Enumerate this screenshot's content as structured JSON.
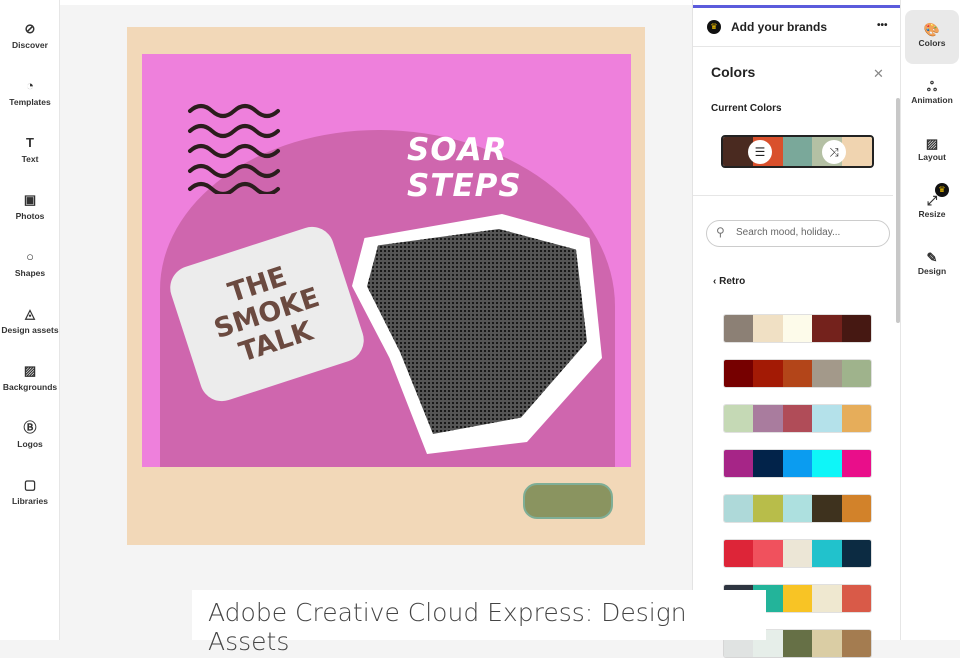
{
  "left_nav": [
    {
      "label": "Discover",
      "icon": "compass-icon",
      "glyph": "⊘"
    },
    {
      "label": "Templates",
      "icon": "templates-icon",
      "glyph": "◔"
    },
    {
      "label": "Text",
      "icon": "text-icon",
      "glyph": "T"
    },
    {
      "label": "Photos",
      "icon": "photos-icon",
      "glyph": "▣"
    },
    {
      "label": "Shapes",
      "icon": "shapes-icon",
      "glyph": "○"
    },
    {
      "label": "Design assets",
      "icon": "design-assets-icon",
      "glyph": "◬"
    },
    {
      "label": "Backgrounds",
      "icon": "backgrounds-icon",
      "glyph": "▨"
    },
    {
      "label": "Logos",
      "icon": "logos-icon",
      "glyph": "Ⓑ"
    },
    {
      "label": "Libraries",
      "icon": "libraries-icon",
      "glyph": "▢"
    }
  ],
  "canvas": {
    "headline": "SOAR STEPS",
    "bubble_text": "THE SMOKE TALK"
  },
  "panel": {
    "brand_label": "Add your brands",
    "more": "•••",
    "title": "Colors",
    "close": "✕",
    "current_label": "Current Colors",
    "current_colors": [
      "#4a2a20",
      "#d9502c",
      "#7aa89a",
      "#b4c0a4",
      "#f0d4b0"
    ],
    "search_placeholder": "Search mood, holiday...",
    "back_label": "Retro",
    "palettes": [
      [
        "#8c8075",
        "#f0e0c4",
        "#fdfbea",
        "#74221c",
        "#461812"
      ],
      [
        "#760000",
        "#a31a05",
        "#b34519",
        "#a3998a",
        "#9fb38c"
      ],
      [
        "#c5d9b5",
        "#a97c9e",
        "#b04c58",
        "#b4e1ea",
        "#e6ad5a"
      ],
      [
        "#a62587",
        "#02234a",
        "#0b9cf0",
        "#0ef6f8",
        "#e90e8a"
      ],
      [
        "#aed9d9",
        "#b8bd4a",
        "#ade0df",
        "#3e321e",
        "#d2822a"
      ],
      [
        "#dd2538",
        "#f0515d",
        "#ece6d6",
        "#21c2cc",
        "#0c2b42"
      ],
      [
        "#2e3540",
        "#23b49a",
        "#f8c425",
        "#efe8d0",
        "#d95a48"
      ],
      [
        "#e0e3e2",
        "#e6eee9",
        "#667046",
        "#dacda4",
        "#a47c50"
      ]
    ]
  },
  "rail": [
    {
      "label": "Colors",
      "icon": "palette-icon",
      "glyph": "🎨"
    },
    {
      "label": "Animation",
      "icon": "animation-icon",
      "glyph": "ஃ"
    },
    {
      "label": "Layout",
      "icon": "layout-icon",
      "glyph": "▨"
    },
    {
      "label": "Resize",
      "icon": "resize-icon",
      "glyph": "⤢"
    },
    {
      "label": "Design",
      "icon": "magic-wand-icon",
      "glyph": "✎"
    }
  ],
  "caption": "Adobe Creative Cloud Express: Design Assets"
}
